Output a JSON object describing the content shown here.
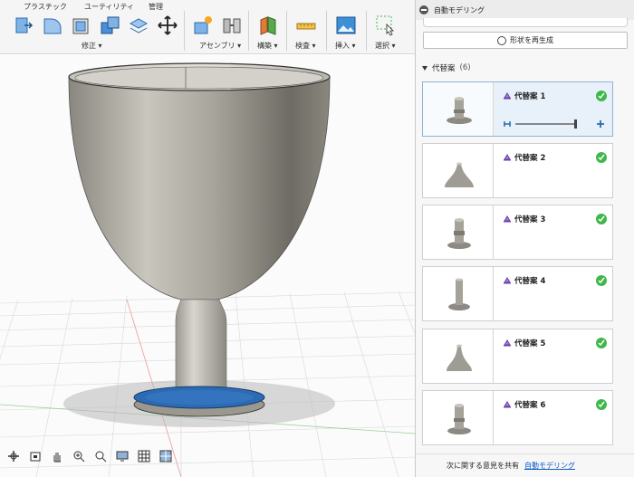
{
  "toolbar": {
    "tabs": [
      "プラスチック",
      "ユーティリティ",
      "管理"
    ],
    "groups": [
      "修正 ▾",
      "アセンブリ ▾",
      "構築 ▾",
      "検査 ▾",
      "挿入 ▾",
      "選択 ▾"
    ]
  },
  "panel": {
    "title": "自動モデリング",
    "regenerate_label": "形状を再生成",
    "alternatives_label": "代替案",
    "alternatives_count": "(6)",
    "alternatives": [
      {
        "label": "代替案 1",
        "selected": true
      },
      {
        "label": "代替案 2",
        "selected": false
      },
      {
        "label": "代替案 3",
        "selected": false
      },
      {
        "label": "代替案 4",
        "selected": false
      },
      {
        "label": "代替案 5",
        "selected": false
      },
      {
        "label": "代替案 6",
        "selected": false
      }
    ],
    "footer_text": "次に関する意見を共有",
    "footer_link": "自動モデリング"
  },
  "colors": {
    "accent": "#0a58ca",
    "check": "#3eb84a",
    "selected_card": "#e8f1f9",
    "base_blue": "#2c6ab3"
  },
  "icons": [
    "press-pull-icon",
    "fillet-icon",
    "shell-icon",
    "combine-icon",
    "offset-face-icon",
    "move-icon",
    "new-component-icon",
    "joint-icon",
    "plane-icon",
    "measure-icon",
    "insert-image-icon",
    "select-box-icon"
  ]
}
